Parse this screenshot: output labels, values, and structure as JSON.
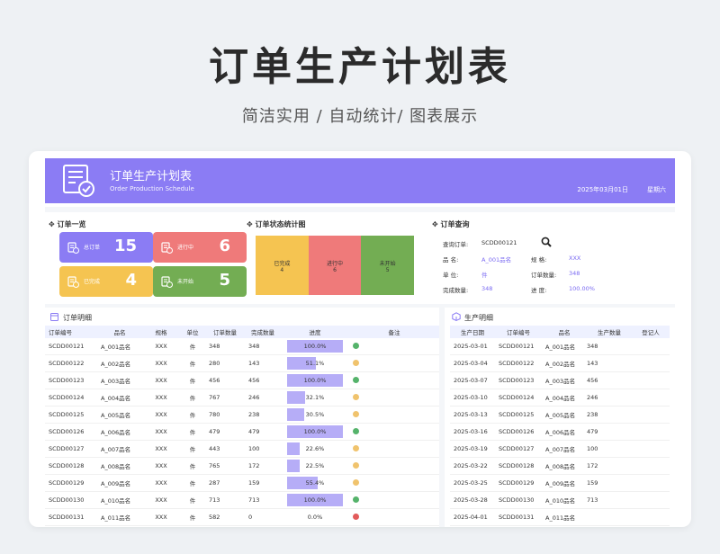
{
  "hero": {
    "title": "订单生产计划表",
    "subtitle": "简洁实用 / 自动统计/ 图表展示"
  },
  "banner": {
    "title": "订单生产计划表",
    "subtitle": "Order Production Schedule",
    "date": "2025年03月01日",
    "weekday": "星期六"
  },
  "overview": {
    "title": "✥ 订单一览",
    "cards": [
      {
        "label": "总订单",
        "value": "15",
        "color": "#8b7cf4",
        "icon": "list-add-icon"
      },
      {
        "label": "进行中",
        "value": "6",
        "color": "#ef7a7a",
        "icon": "clock-doc-icon"
      },
      {
        "label": "已完成",
        "value": "4",
        "color": "#f5c451",
        "icon": "check-doc-icon"
      },
      {
        "label": "未开始",
        "value": "5",
        "color": "#73ad53",
        "icon": "minus-doc-icon"
      }
    ]
  },
  "status_chart": {
    "title": "✥ 订单状态统计图",
    "segments": [
      {
        "label": "已完成",
        "value": "4",
        "color": "#f5c451"
      },
      {
        "label": "进行中",
        "value": "6",
        "color": "#ef7a7a"
      },
      {
        "label": "未开始",
        "value": "5",
        "color": "#73ad53"
      }
    ]
  },
  "query": {
    "title": "✥ 订单查询",
    "order_label": "查询订单:",
    "order_value": "SCDD00121",
    "name_label": "品        名:",
    "name_value": "A_001品名",
    "spec_label": "规        格:",
    "spec_value": "XXX",
    "unit_label": "单        位:",
    "unit_value": "件",
    "qty_label": "订单数量:",
    "qty_value": "348",
    "done_label": "完成数量:",
    "done_value": "348",
    "progress_label": "进        度:",
    "progress_value": "100.00%"
  },
  "order_table": {
    "title": "订单明细",
    "headers": [
      "订单编号",
      "品名",
      "规格",
      "单位",
      "订单数量",
      "完成数量",
      "进度",
      "备注"
    ],
    "rows": [
      {
        "id": "SCDD00121",
        "name": "A_001品名",
        "spec": "XXX",
        "unit": "件",
        "qty": "348",
        "done": "348",
        "pct": "100.0%",
        "fill": 1.0,
        "status": "done"
      },
      {
        "id": "SCDD00122",
        "name": "A_002品名",
        "spec": "XXX",
        "unit": "件",
        "qty": "280",
        "done": "143",
        "pct": "51.1%",
        "fill": 0.511,
        "status": "progress"
      },
      {
        "id": "SCDD00123",
        "name": "A_003品名",
        "spec": "XXX",
        "unit": "件",
        "qty": "456",
        "done": "456",
        "pct": "100.0%",
        "fill": 1.0,
        "status": "done"
      },
      {
        "id": "SCDD00124",
        "name": "A_004品名",
        "spec": "XXX",
        "unit": "件",
        "qty": "767",
        "done": "246",
        "pct": "32.1%",
        "fill": 0.321,
        "status": "progress"
      },
      {
        "id": "SCDD00125",
        "name": "A_005品名",
        "spec": "XXX",
        "unit": "件",
        "qty": "780",
        "done": "238",
        "pct": "30.5%",
        "fill": 0.305,
        "status": "progress"
      },
      {
        "id": "SCDD00126",
        "name": "A_006品名",
        "spec": "XXX",
        "unit": "件",
        "qty": "479",
        "done": "479",
        "pct": "100.0%",
        "fill": 1.0,
        "status": "done"
      },
      {
        "id": "SCDD00127",
        "name": "A_007品名",
        "spec": "XXX",
        "unit": "件",
        "qty": "443",
        "done": "100",
        "pct": "22.6%",
        "fill": 0.226,
        "status": "progress"
      },
      {
        "id": "SCDD00128",
        "name": "A_008品名",
        "spec": "XXX",
        "unit": "件",
        "qty": "765",
        "done": "172",
        "pct": "22.5%",
        "fill": 0.225,
        "status": "progress"
      },
      {
        "id": "SCDD00129",
        "name": "A_009品名",
        "spec": "XXX",
        "unit": "件",
        "qty": "287",
        "done": "159",
        "pct": "55.4%",
        "fill": 0.554,
        "status": "progress"
      },
      {
        "id": "SCDD00130",
        "name": "A_010品名",
        "spec": "XXX",
        "unit": "件",
        "qty": "713",
        "done": "713",
        "pct": "100.0%",
        "fill": 1.0,
        "status": "done"
      },
      {
        "id": "SCDD00131",
        "name": "A_011品名",
        "spec": "XXX",
        "unit": "件",
        "qty": "582",
        "done": "0",
        "pct": "0.0%",
        "fill": 0.0,
        "status": "none"
      }
    ]
  },
  "production_table": {
    "title": "生产明细",
    "headers": [
      "生产日期",
      "订单编号",
      "品名",
      "生产数量",
      "登记人"
    ],
    "rows": [
      {
        "date": "2025-03-01",
        "id": "SCDD00121",
        "name": "A_001品名",
        "qty": "348",
        "reg": ""
      },
      {
        "date": "2025-03-04",
        "id": "SCDD00122",
        "name": "A_002品名",
        "qty": "143",
        "reg": ""
      },
      {
        "date": "2025-03-07",
        "id": "SCDD00123",
        "name": "A_003品名",
        "qty": "456",
        "reg": ""
      },
      {
        "date": "2025-03-10",
        "id": "SCDD00124",
        "name": "A_004品名",
        "qty": "246",
        "reg": ""
      },
      {
        "date": "2025-03-13",
        "id": "SCDD00125",
        "name": "A_005品名",
        "qty": "238",
        "reg": ""
      },
      {
        "date": "2025-03-16",
        "id": "SCDD00126",
        "name": "A_006品名",
        "qty": "479",
        "reg": ""
      },
      {
        "date": "2025-03-19",
        "id": "SCDD00127",
        "name": "A_007品名",
        "qty": "100",
        "reg": ""
      },
      {
        "date": "2025-03-22",
        "id": "SCDD00128",
        "name": "A_008品名",
        "qty": "172",
        "reg": ""
      },
      {
        "date": "2025-03-25",
        "id": "SCDD00129",
        "name": "A_009品名",
        "qty": "159",
        "reg": ""
      },
      {
        "date": "2025-03-28",
        "id": "SCDD00130",
        "name": "A_010品名",
        "qty": "713",
        "reg": ""
      },
      {
        "date": "2025-04-01",
        "id": "SCDD00131",
        "name": "A_011品名",
        "qty": "",
        "reg": ""
      }
    ]
  },
  "status_colors": {
    "done": "#55b36b",
    "progress": "#f0c36d",
    "none": "#e25b5b"
  }
}
